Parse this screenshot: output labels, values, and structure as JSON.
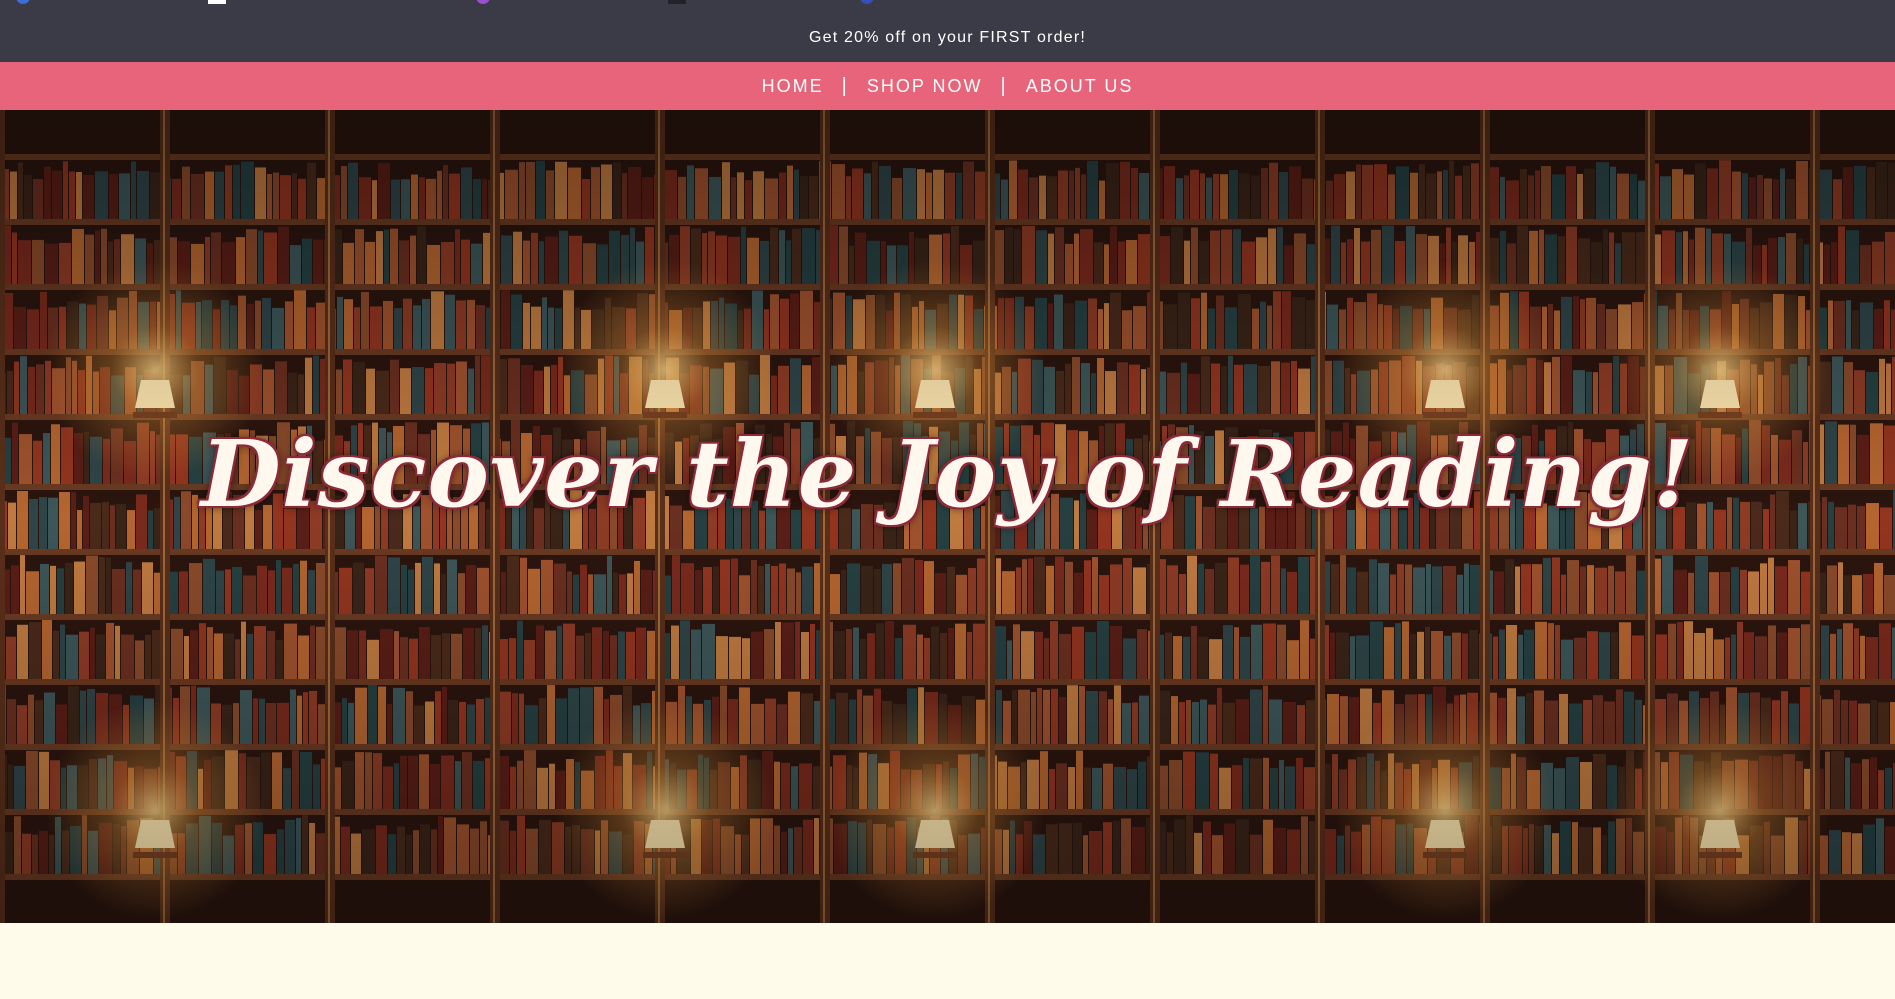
{
  "promo": {
    "text": "Get 20% off on your FIRST order!"
  },
  "nav": {
    "items": [
      {
        "label": "HOME"
      },
      {
        "label": "SHOP NOW"
      },
      {
        "label": "ABOUT US"
      }
    ],
    "separator": "|"
  },
  "hero": {
    "title": "Discover the Joy of Reading!"
  },
  "colors": {
    "promo_bg": "#3b3a47",
    "nav_bg": "#e8647a",
    "page_bg": "#fffbea",
    "title_text": "#fff8ee",
    "title_outline": "#8c2a3a"
  },
  "icons": [
    "blue-circle-icon",
    "white-square-icon",
    "purple-circle-icon",
    "dark-square-icon",
    "blue-circle-icon"
  ]
}
